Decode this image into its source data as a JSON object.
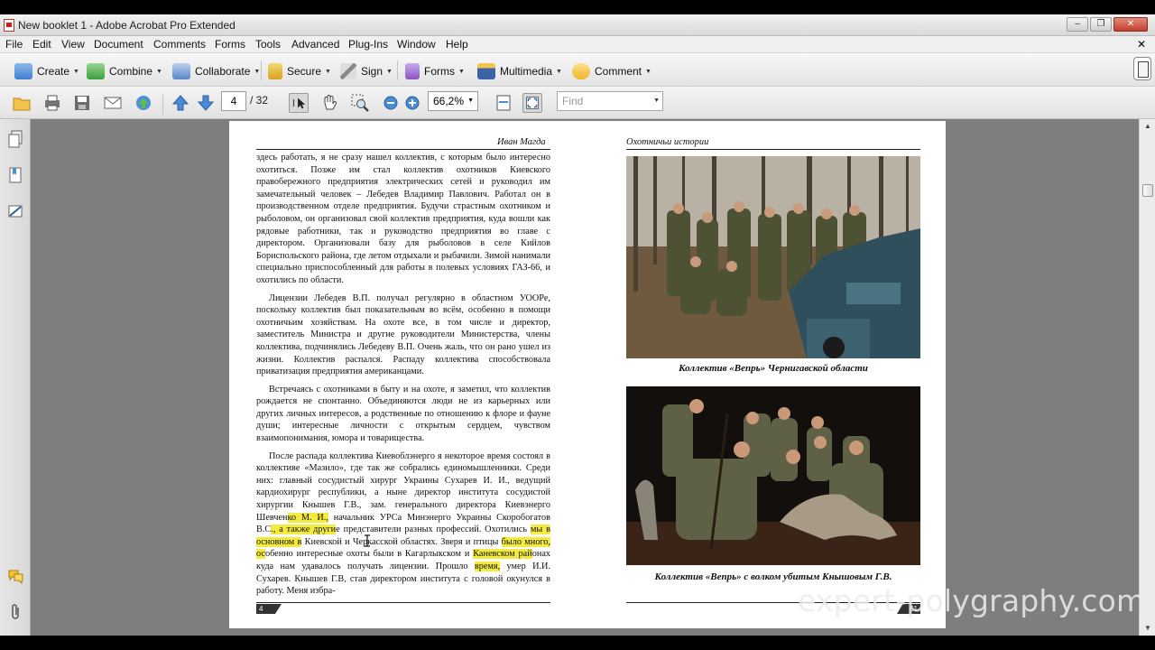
{
  "window": {
    "title": "New booklet 1 - Adobe Acrobat Pro Extended",
    "minimize": "–",
    "restore": "❐",
    "close": "✕"
  },
  "menubar": {
    "items": [
      "File",
      "Edit",
      "View",
      "Document",
      "Comments",
      "Forms",
      "Tools",
      "Advanced",
      "Plug-Ins",
      "Window",
      "Help"
    ],
    "close_glyph": "✕"
  },
  "tasks": {
    "items": [
      {
        "label": "Create",
        "icon": "create-icon",
        "color": "#3f7fd0"
      },
      {
        "label": "Combine",
        "icon": "combine-icon",
        "color": "#3aa03a"
      },
      {
        "label": "Collaborate",
        "icon": "collaborate-icon",
        "color": "#5a86c8"
      },
      {
        "label": "Secure",
        "icon": "lock-icon",
        "color": "#d9a21c"
      },
      {
        "label": "Sign",
        "icon": "pen-icon",
        "color": "#888888"
      },
      {
        "label": "Forms",
        "icon": "forms-icon",
        "color": "#8a57c2"
      },
      {
        "label": "Multimedia",
        "icon": "multimedia-icon",
        "color": "#3a63a8"
      },
      {
        "label": "Comment",
        "icon": "comment-icon",
        "color": "#f0b428"
      }
    ]
  },
  "toolbar": {
    "current_page": "4",
    "page_count": "/ 32",
    "zoom": "66,2%",
    "find_placeholder": "Find"
  },
  "document": {
    "left_page": {
      "running_head": "Иван Магда",
      "page_number": "4",
      "p1": "здесь работать, я не сразу нашел коллектив, с которым было интересно охотиться. Позже им стал коллектив охотников Киевского правобережного предприятия электрических сетей и руководил им замечательный человек – Лебедев Владимир Павлович. Работал он в производственном отделе предприятия. Будучи страстным охотником и рыболовом, он организовал свой коллектив предприятия, куда вошли как рядовые работники, так и руководство предприятия во главе с директором. Организовали базу для рыболовов в селе Кийлов Бориспольского района, где летом отдыхали и рыбачили. Зимой нанимали специально приспособленный для работы в полевых условиях ГАЗ-66, и охотились по области.",
      "p2": "Лицензии Лебедев В.П. получал регулярно в областном УООРе, поскольку коллектив был показательным во всём, особенно в помощи охотничьим хозяйствам. На охоте все, в том числе и директор, заместитель Министра и другие руководители Министерства, члены коллектива, подчинялись Лебедеву В.П. Очень жаль, что он рано ушел из жизни. Коллектив распался. Распаду коллектива способствовала приватизация предприятия американцами.",
      "p3": "Встречаясь с охотниками в быту и на охоте, я заметил, что коллектив рождается не спонтанно. Объединяются люди не из карьерных или других личных интересов, а родственные по отношению к флоре и фауне души; интересные личности с открытым сердцем, чувством взаимопонимания, юмора и товарищества.",
      "p4_a": "После распада коллектива Киевоблэнерго я некоторое время состоял в коллективе «Мазило», где так же собрались единомышленники. Среди них: главный сосудистый хирург Украины Сухарев И. И., ведущий кардиохирург республики, а ныне директор института сосудистой хирургии Кнышев Г.В., зам. генерального директора Киевэнерго Шевчен",
      "p4_hl1": "ко М. И.,",
      "p4_b": " начальник УРСа Минэнерго Украины Скоробогатов В.С",
      "p4_hl2": "., а также други",
      "p4_c": "е представители разных профессий. Охотились ",
      "p4_hl3": "мы в основном в",
      "p4_d": " Киевской и Черкасской областях. Зверя и птицы ",
      "p4_hl4": "было много, ос",
      "p4_e": "обенно интересные охоты были в Кагарлыкском и ",
      "p4_hl5": "Каневском рай",
      "p4_f": "онах куда нам удавалось получать лицензии. Прошло ",
      "p4_hl6": "время,",
      "p4_g": " умер И.И. Сухарев. Кнышев Г.В, став директором института с головой окунулся в работу. Меня избра-"
    },
    "right_page": {
      "running_head": "Охотничьи истории",
      "caption1": "Коллектив «Вепрь» Чернигавской области",
      "caption2": "Коллектив «Вепрь» с волком убитым Кнышовым Г.В.",
      "page_number": "61"
    }
  },
  "watermark": "expert-polygraphy.com"
}
